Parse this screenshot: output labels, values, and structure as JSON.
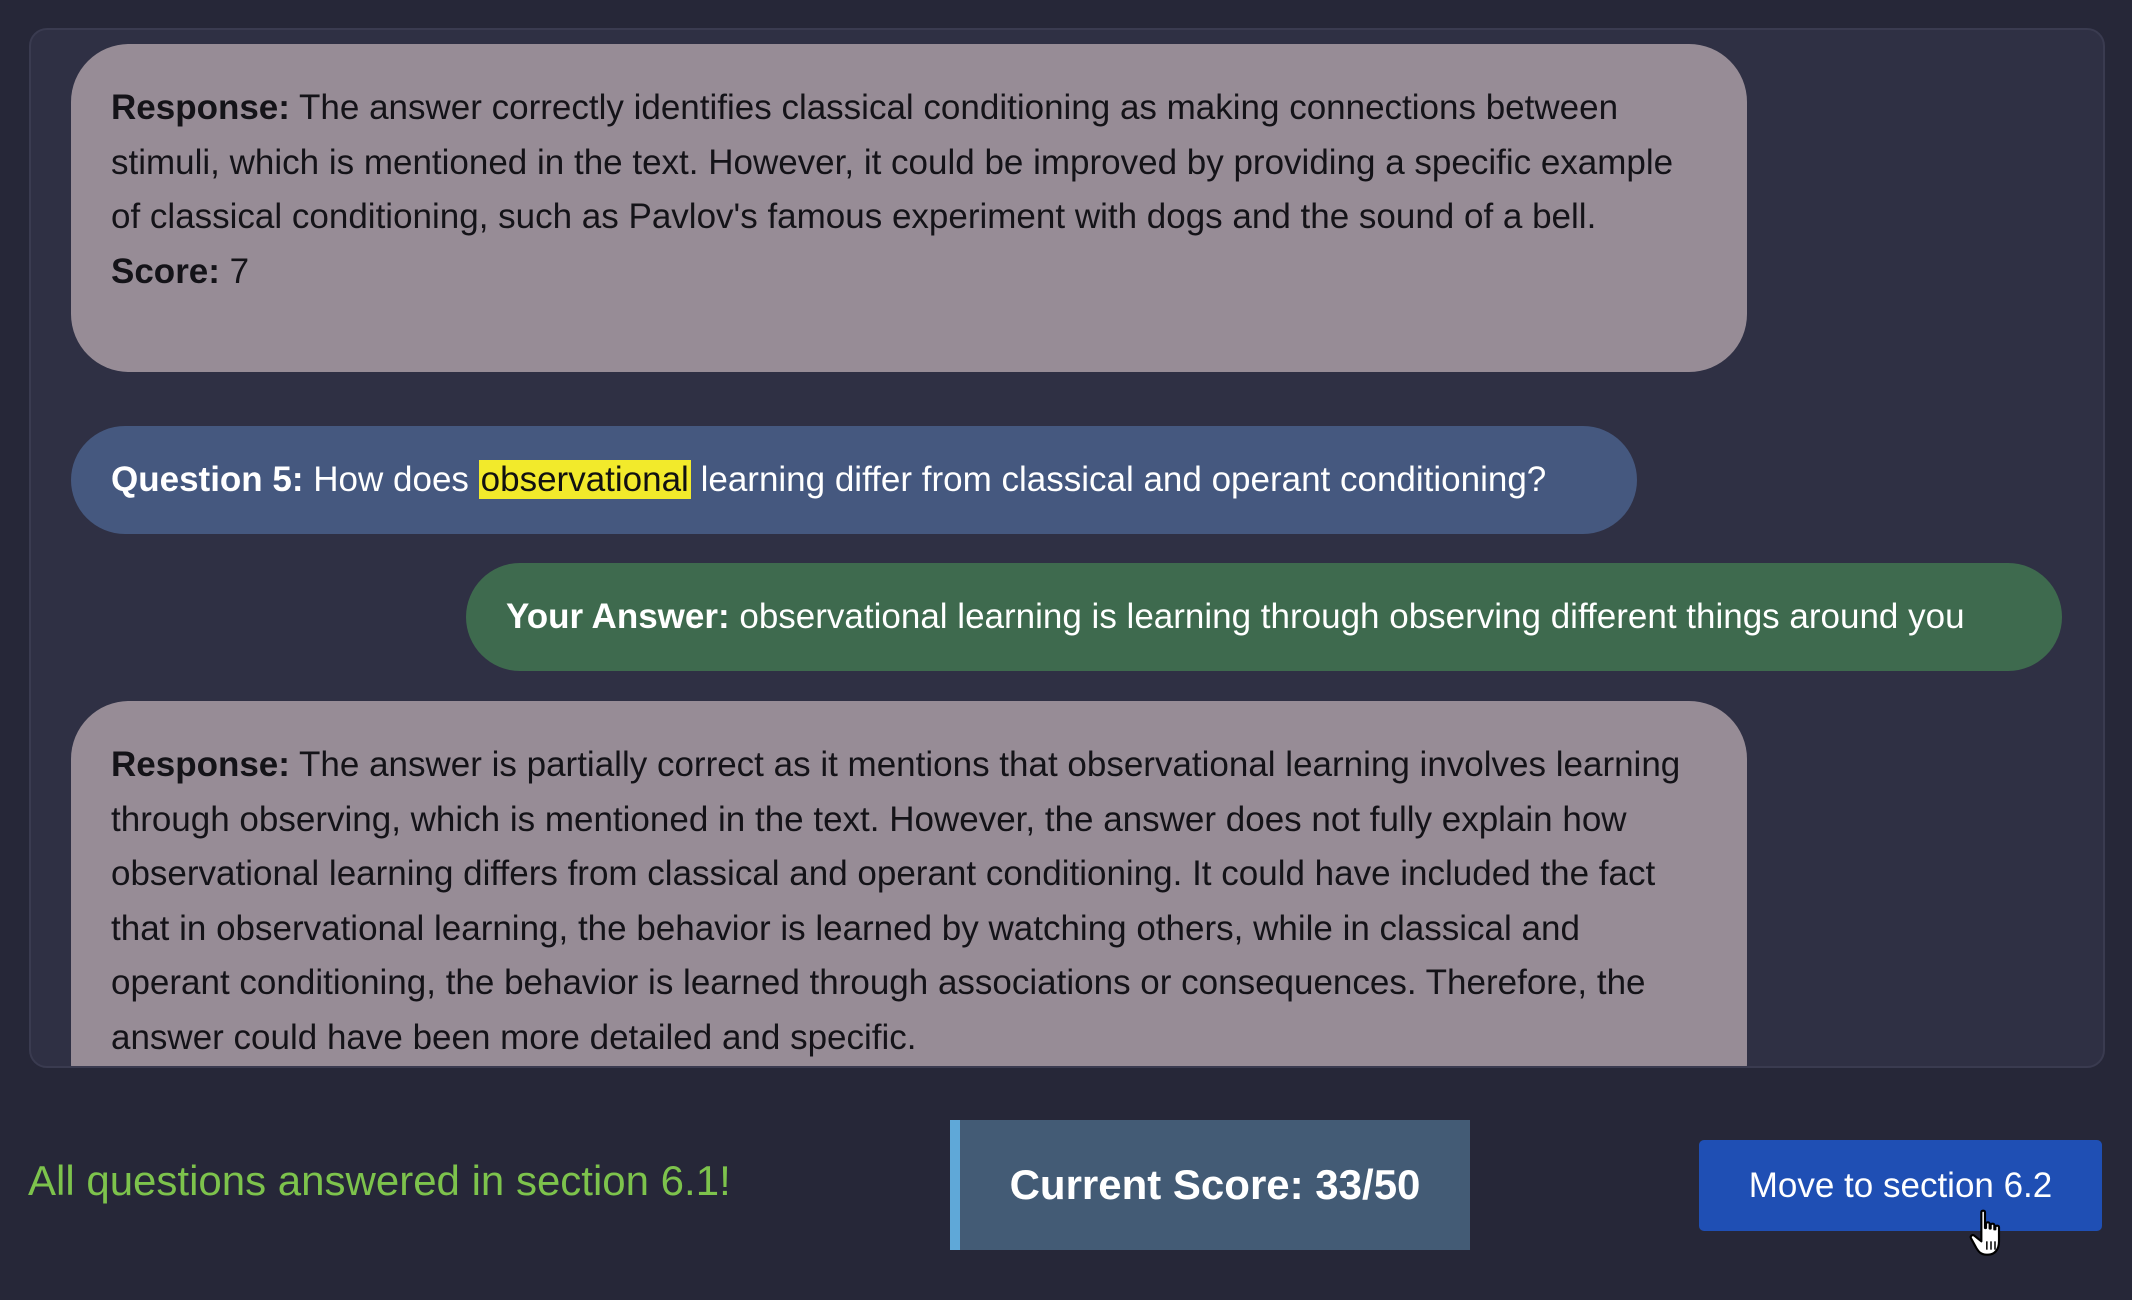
{
  "chat": {
    "response_label": "Response:",
    "score_label": "Score:",
    "first_response": {
      "text": "The answer correctly identifies classical conditioning as making connections between stimuli, which is mentioned in the text. However, it could be improved by providing a specific example of classical conditioning, such as Pavlov's famous experiment with dogs and the sound of a bell.",
      "score": "7"
    },
    "question": {
      "label": "Question 5:",
      "text_before": "How does",
      "highlighted_word": "observational",
      "text_after": "learning differ from classical and operant conditioning?"
    },
    "user_answer": {
      "label": "Your Answer:",
      "text": "observational learning is learning through observing different things around you"
    },
    "second_response": {
      "text": "The answer is partially correct as it mentions that observational learning involves learning through observing, which is mentioned in the text. However, the answer does not fully explain how observational learning differs from classical and operant conditioning. It could have included the fact that in observational learning, the behavior is learned by watching others, while in classical and operant conditioning, the behavior is learned through associations or consequences. Therefore, the answer could have been more detailed and specific."
    }
  },
  "footer": {
    "status_text": "All questions answered in section 6.1!",
    "score_text": "Current Score: 33/50",
    "next_button_label": "Move to section 6.2"
  },
  "colors": {
    "page_background": "#262738",
    "response_bubble": "#978c96",
    "question_bubble": "#45587f",
    "answer_bubble": "#3e6a4e",
    "highlight": "#f2ea2b",
    "status_green": "#7dc34c",
    "score_box": "#435b75",
    "score_accent": "#5fa8d8",
    "button_blue": "#1f4fb4"
  },
  "icons": {
    "cursor": "hand-pointer-icon"
  }
}
